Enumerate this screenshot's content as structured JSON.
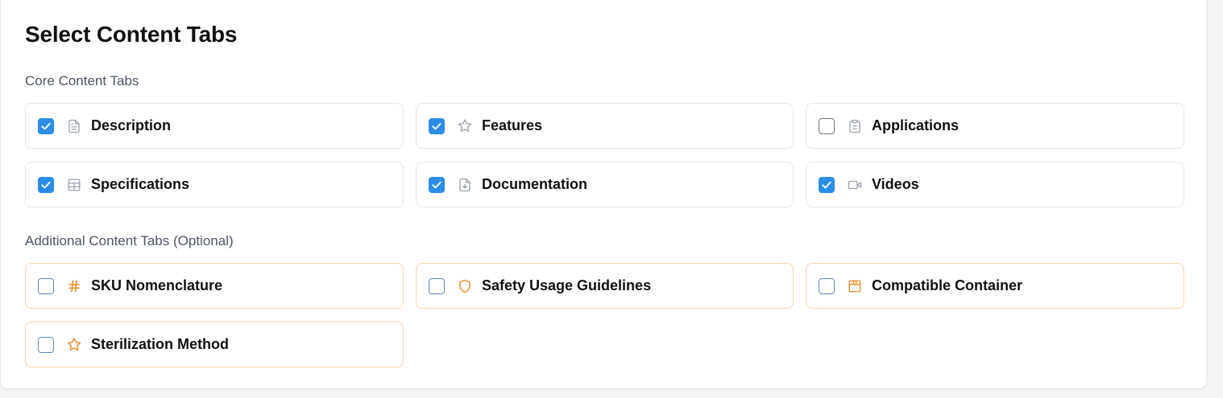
{
  "title": "Select Content Tabs",
  "colors": {
    "accent": "#2b8de6",
    "core_icon": "#9ca3af",
    "additional_icon": "#f08a24",
    "additional_border": "#f9d6a8"
  },
  "core": {
    "label": "Core Content Tabs",
    "items": [
      {
        "label": "Description",
        "checked": true,
        "icon": "document-icon"
      },
      {
        "label": "Features",
        "checked": true,
        "icon": "star-icon"
      },
      {
        "label": "Applications",
        "checked": false,
        "icon": "clipboard-icon"
      },
      {
        "label": "Specifications",
        "checked": true,
        "icon": "table-icon"
      },
      {
        "label": "Documentation",
        "checked": true,
        "icon": "file-download-icon"
      },
      {
        "label": "Videos",
        "checked": true,
        "icon": "video-icon"
      }
    ]
  },
  "additional": {
    "label": "Additional Content Tabs (Optional)",
    "items": [
      {
        "label": "SKU Nomenclature",
        "checked": false,
        "icon": "hash-icon"
      },
      {
        "label": "Safety Usage Guidelines",
        "checked": false,
        "icon": "shield-icon"
      },
      {
        "label": "Compatible Container",
        "checked": false,
        "icon": "package-icon"
      },
      {
        "label": "Sterilization Method",
        "checked": false,
        "icon": "star-icon"
      }
    ]
  }
}
